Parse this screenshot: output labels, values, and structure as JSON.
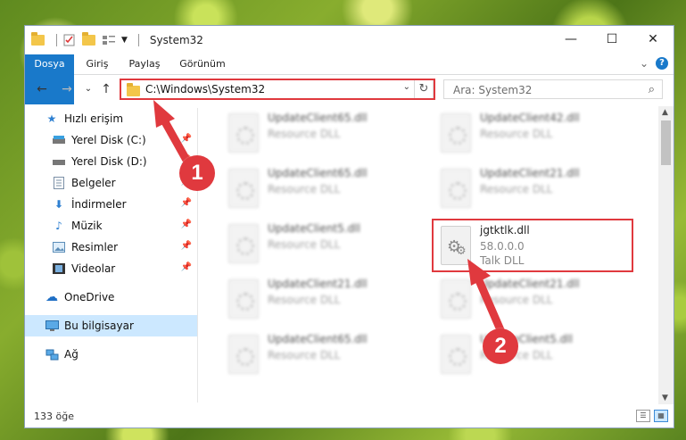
{
  "window": {
    "title": "System32",
    "controls": {
      "minimize": "—",
      "maximize": "☐",
      "close": "✕"
    }
  },
  "ribbon": {
    "tabs": [
      "Dosya",
      "Giriş",
      "Paylaş",
      "Görünüm"
    ],
    "expand": "⌄",
    "help": "?"
  },
  "navigation": {
    "back": "←",
    "forward": "→",
    "recent": "⌄",
    "up": "↑",
    "address": "C:\\Windows\\System32",
    "address_dropdown": "⌄",
    "refresh": "↻",
    "search_placeholder": "Ara: System32",
    "search_icon": "⌕"
  },
  "sidebar": {
    "items": [
      {
        "label": "Hızlı erişim",
        "icon": "star-icon",
        "pinned": false
      },
      {
        "label": "Yerel Disk (C:)",
        "icon": "drive-icon",
        "pinned": true
      },
      {
        "label": "Yerel Disk (D:)",
        "icon": "drive-icon",
        "pinned": true
      },
      {
        "label": "Belgeler",
        "icon": "documents-icon",
        "pinned": true
      },
      {
        "label": "İndirmeler",
        "icon": "download-icon",
        "pinned": true
      },
      {
        "label": "Müzik",
        "icon": "music-icon",
        "pinned": true
      },
      {
        "label": "Resimler",
        "icon": "pictures-icon",
        "pinned": true
      },
      {
        "label": "Videolar",
        "icon": "video-icon",
        "pinned": true
      },
      {
        "label": "OneDrive",
        "icon": "cloud-icon",
        "pinned": false
      },
      {
        "label": "Bu bilgisayar",
        "icon": "computer-icon",
        "pinned": false,
        "selected": true
      },
      {
        "label": "Ağ",
        "icon": "network-icon",
        "pinned": false
      }
    ]
  },
  "files": [
    {
      "name": "UpdateClient65.dll",
      "desc": "Resource DLL"
    },
    {
      "name": "UpdateClient42.dll",
      "desc": "Resource DLL"
    },
    {
      "name": "UpdateClient65.dll",
      "desc": "Resource DLL"
    },
    {
      "name": "UpdateClient21.dll",
      "desc": "Resource DLL"
    },
    {
      "name": "UpdateClient5.dll",
      "desc": "Resource DLL"
    },
    {
      "name": "jgtktlk.dll",
      "version": "58.0.0.0",
      "desc": "Talk DLL"
    },
    {
      "name": "UpdateClient21.dll",
      "desc": "Resource DLL"
    },
    {
      "name": "UpdateClient21.dll",
      "desc": "Resource DLL"
    },
    {
      "name": "UpdateClient65.dll",
      "desc": "Resource DLL"
    },
    {
      "name": "UpdateClient5.dll",
      "desc": "Resource DLL"
    }
  ],
  "status": {
    "count": "133 öğe"
  },
  "annotations": {
    "step1": "1",
    "step2": "2",
    "color": "#e0393e"
  }
}
